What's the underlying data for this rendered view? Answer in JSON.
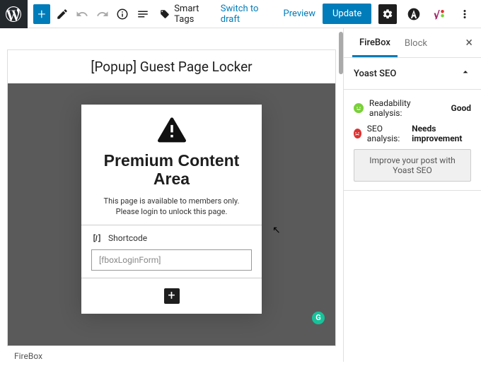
{
  "toolbar": {
    "smart_tags": "Smart Tags",
    "switch_draft": "Switch to draft",
    "preview": "Preview",
    "update": "Update"
  },
  "canvas": {
    "title": "[Popup] Guest Page Locker",
    "footer_brand": "FireBox"
  },
  "popup": {
    "heading": "Premium Content Area",
    "subtext": "This page is available to members only. Please login to unlock this page.",
    "shortcode_label": "Shortcode",
    "shortcode_value": "[fboxLoginForm]"
  },
  "sidebar": {
    "tabs": {
      "firebox": "FireBox",
      "block": "Block"
    },
    "panel_title": "Yoast SEO",
    "readability_label": "Readability analysis:",
    "readability_value": "Good",
    "seo_label": "SEO analysis:",
    "seo_value": "Needs improvement",
    "improve_btn": "Improve your post with Yoast SEO"
  }
}
